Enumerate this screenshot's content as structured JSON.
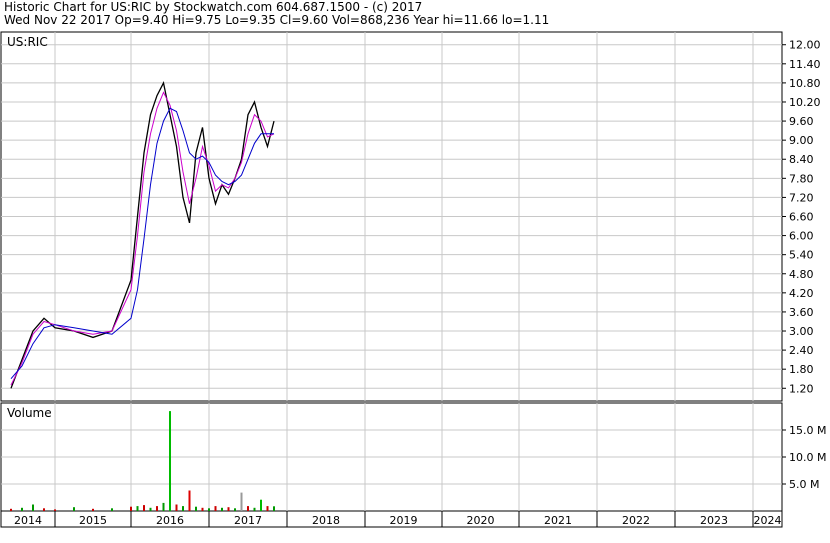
{
  "header": {
    "line1": "Historic Chart for US:RIC by Stockwatch.com 604.687.1500 - (c) 2017",
    "line2": "Wed Nov 22 2017   Op=9.40   Hi=9.75   Lo=9.35   Cl=9.60   Vol=868,236   Year hi=11.66   lo=1.11"
  },
  "chart_data": [
    {
      "type": "line",
      "title": "US:RIC",
      "x": [
        "2014-01",
        "2014-04",
        "2014-07",
        "2014-10",
        "2015-01",
        "2015-04",
        "2015-07",
        "2015-10",
        "2016-01",
        "2016-02",
        "2016-03",
        "2016-04",
        "2016-05",
        "2016-06",
        "2016-07",
        "2016-08",
        "2016-09",
        "2016-10",
        "2016-11",
        "2016-12",
        "2017-01",
        "2017-02",
        "2017-03",
        "2017-04",
        "2017-05",
        "2017-06",
        "2017-07",
        "2017-08",
        "2017-09",
        "2017-10",
        "2017-11"
      ],
      "series": [
        {
          "values": [
            1.2,
            2.1,
            3.0,
            3.4,
            3.1,
            3.0,
            2.8,
            3.0,
            4.6,
            6.6,
            8.6,
            9.8,
            10.4,
            10.8,
            9.8,
            8.8,
            7.2,
            6.4,
            8.6,
            9.4,
            7.8,
            7.0,
            7.6,
            7.3,
            7.8,
            8.4,
            9.8,
            10.2,
            9.4,
            8.8,
            9.6
          ]
        },
        {
          "values": [
            1.3,
            2.0,
            2.9,
            3.3,
            3.2,
            3.0,
            2.9,
            3.0,
            4.3,
            6.0,
            8.0,
            9.2,
            10.0,
            10.5,
            10.1,
            9.3,
            8.0,
            7.0,
            7.8,
            8.8,
            8.2,
            7.4,
            7.6,
            7.5,
            7.8,
            8.3,
            9.2,
            9.8,
            9.6,
            9.1,
            9.2
          ]
        },
        {
          "values": [
            1.5,
            1.9,
            2.6,
            3.1,
            3.2,
            3.1,
            3.0,
            2.9,
            3.4,
            4.3,
            5.9,
            7.6,
            8.9,
            9.6,
            10.0,
            9.9,
            9.3,
            8.6,
            8.4,
            8.5,
            8.3,
            7.9,
            7.7,
            7.6,
            7.7,
            7.9,
            8.4,
            8.9,
            9.2,
            9.2,
            9.2
          ]
        }
      ],
      "ylim": [
        0.8,
        12.4
      ],
      "yticks": [
        "12.00",
        "11.40",
        "10.80",
        "10.20",
        "9.60",
        "9.00",
        "8.40",
        "7.80",
        "7.20",
        "6.60",
        "6.00",
        "5.40",
        "4.80",
        "4.20",
        "3.60",
        "3.00",
        "2.40",
        "1.80",
        "1.20"
      ],
      "colors": {
        "price": "#000000",
        "ma_short": "#cc00cc",
        "ma_long": "#0000cc",
        "grid": "#c8c8c8"
      }
    },
    {
      "type": "bar",
      "title": "Volume",
      "x": [
        "2014-01",
        "2014-04",
        "2014-07",
        "2014-10",
        "2015-01",
        "2015-04",
        "2015-07",
        "2015-10",
        "2016-01",
        "2016-02",
        "2016-03",
        "2016-04",
        "2016-05",
        "2016-06",
        "2016-07",
        "2016-08",
        "2016-09",
        "2016-10",
        "2016-11",
        "2016-12",
        "2017-01",
        "2017-02",
        "2017-03",
        "2017-04",
        "2017-05",
        "2017-06",
        "2017-07",
        "2017-08",
        "2017-09",
        "2017-10",
        "2017-11"
      ],
      "values": [
        0.4,
        0.6,
        1.2,
        0.5,
        0.3,
        0.7,
        0.4,
        0.5,
        0.8,
        0.9,
        1.1,
        0.6,
        0.9,
        1.5,
        18.5,
        1.2,
        0.9,
        3.8,
        0.8,
        0.6,
        0.5,
        0.9,
        0.6,
        0.7,
        0.5,
        3.4,
        0.9,
        0.6,
        2.1,
        0.9,
        0.87
      ],
      "bar_colors": [
        "#cc0000",
        "#009900",
        "#009900",
        "#cc0000",
        "#cc0000",
        "#009900",
        "#cc0000",
        "#009900",
        "#cc0000",
        "#009900",
        "#cc0000",
        "#009900",
        "#cc0000",
        "#009900",
        "#00bb00",
        "#cc0000",
        "#009900",
        "#dd0000",
        "#009900",
        "#cc0000",
        "#009900",
        "#cc0000",
        "#009900",
        "#cc0000",
        "#009900",
        "#999999",
        "#cc0000",
        "#009900",
        "#00bb00",
        "#cc0000",
        "#009900"
      ],
      "unit": "M",
      "ylim": [
        0,
        20
      ],
      "yticks": [
        "15.0 M",
        "10.0 M",
        "5.0 M"
      ]
    }
  ],
  "time_axis": {
    "labels": [
      "2014",
      "2015",
      "2016",
      "2017",
      "2018",
      "2019",
      "2020",
      "2021",
      "2022",
      "2023",
      "2024"
    ]
  }
}
